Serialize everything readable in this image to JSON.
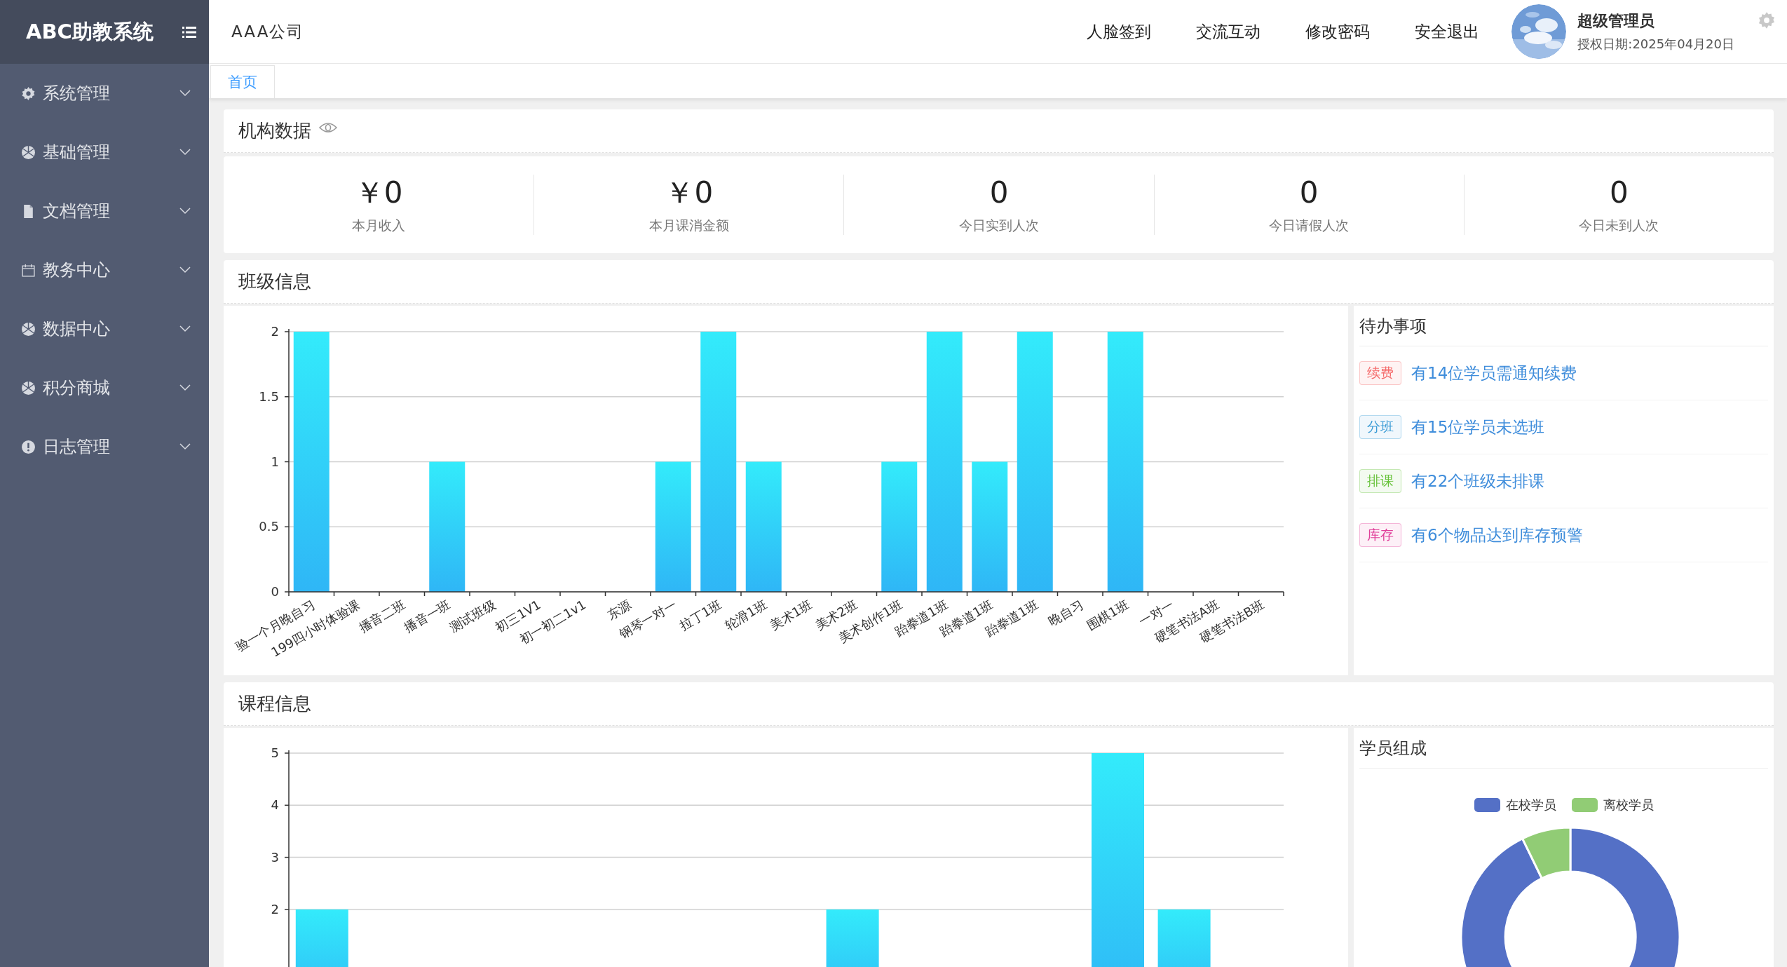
{
  "sidebar": {
    "title": "ABC助教系统",
    "items": [
      {
        "label": "系统管理",
        "expanded": false
      },
      {
        "label": "基础管理",
        "expanded": false
      },
      {
        "label": "文档管理",
        "expanded": false
      },
      {
        "label": "教务中心",
        "expanded": false
      },
      {
        "label": "数据中心",
        "expanded": false
      },
      {
        "label": "积分商城",
        "expanded": false
      },
      {
        "label": "日志管理",
        "expanded": false
      }
    ]
  },
  "header": {
    "company": "AAA公司",
    "nav": [
      "人脸签到",
      "交流互动",
      "修改密码",
      "安全退出"
    ],
    "user": {
      "name": "超级管理员",
      "license": "授权日期:2025年04月20日"
    }
  },
  "tabs": [
    {
      "label": "首页",
      "selected": true
    }
  ],
  "org_data": {
    "title": "机构数据",
    "stats": [
      {
        "value": "￥0",
        "label": "本月收入"
      },
      {
        "value": "￥0",
        "label": "本月课消金额"
      },
      {
        "value": "0",
        "label": "今日实到人次"
      },
      {
        "value": "0",
        "label": "今日请假人次"
      },
      {
        "value": "0",
        "label": "今日未到人次"
      }
    ]
  },
  "class_info": {
    "title": "班级信息",
    "chart_data": {
      "type": "bar",
      "categories": [
        "验一个月晚自习",
        "199四小时体验课",
        "播音二班",
        "播音一班",
        "测试班级",
        "初三1V1",
        "初一初二1v1",
        "东源",
        "钢琴一对一",
        "拉丁1班",
        "轮滑1班",
        "美术1班",
        "美术2班",
        "美术创作1班",
        "跆拳道1班",
        "跆拳道1班",
        "跆拳道1班",
        "晚自习",
        "围棋1班",
        "一对一",
        "硬笔书法A班",
        "硬笔书法B班"
      ],
      "values": [
        2,
        0,
        0,
        1,
        0,
        0,
        0,
        0,
        1,
        2,
        1,
        0,
        0,
        1,
        2,
        1,
        2,
        0,
        2,
        0,
        0,
        0
      ],
      "ylim": [
        0,
        2
      ],
      "yticks": [
        0,
        0.5,
        1,
        1.5,
        2
      ],
      "grid": true
    },
    "todo": {
      "title": "待办事项",
      "items": [
        {
          "tag": "续费",
          "text": "有14位学员需通知续费",
          "color": "#f56c6c"
        },
        {
          "tag": "分班",
          "text": "有15位学员未选班",
          "color": "#3a9bd5"
        },
        {
          "tag": "排课",
          "text": "有22个班级未排课",
          "color": "#67c23a"
        },
        {
          "tag": "库存",
          "text": "有6个物品达到库存预警",
          "color": "#e0409a"
        }
      ]
    }
  },
  "course_info": {
    "title": "课程信息",
    "chart_data": {
      "type": "bar",
      "values": [
        2,
        null,
        null,
        null,
        null,
        null,
        null,
        null,
        2,
        null,
        null,
        null,
        5,
        2,
        null
      ],
      "ylim": [
        0,
        5
      ],
      "yticks": [
        2,
        3,
        4,
        5
      ],
      "grid": true
    },
    "student_composition": {
      "title": "学员组成",
      "legend": [
        {
          "label": "在校学员",
          "color": "#5470c6"
        },
        {
          "label": "离校学员",
          "color": "#91cc75"
        }
      ]
    }
  }
}
